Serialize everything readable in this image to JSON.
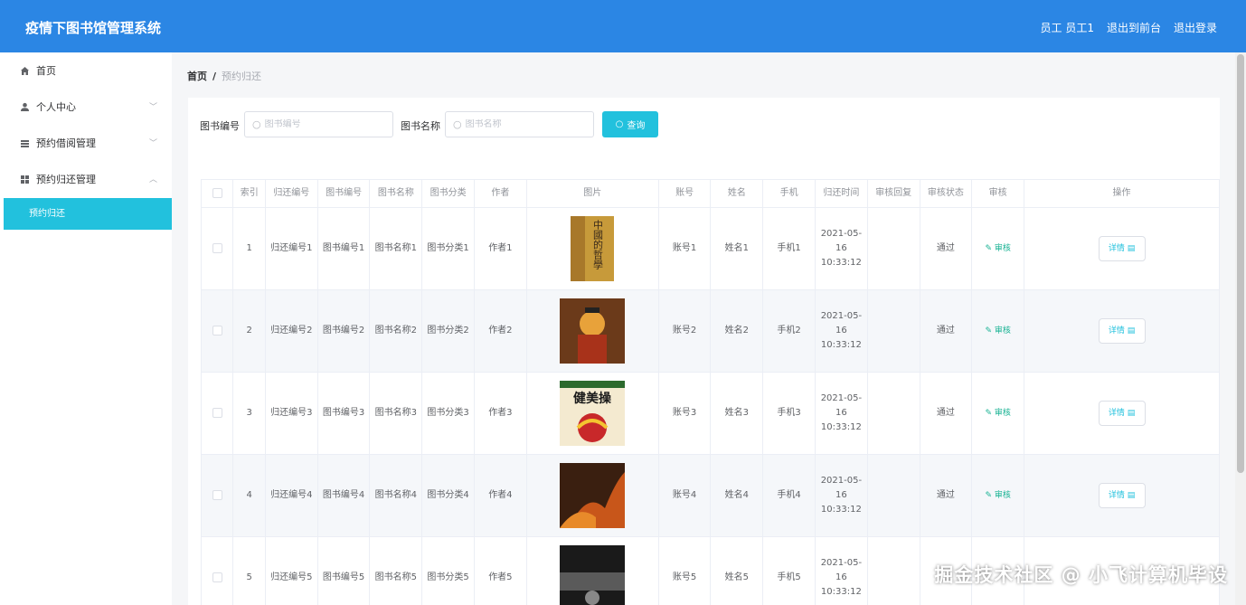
{
  "header": {
    "title": "疫情下图书馆管理系统",
    "nav": [
      "员工 员工1",
      "退出到前台",
      "退出登录"
    ]
  },
  "sidebar": {
    "items": [
      {
        "label": "首页",
        "icon": "home-icon"
      },
      {
        "label": "个人中心",
        "icon": "user-icon"
      },
      {
        "label": "预约借阅管理",
        "icon": "book-stack-icon"
      },
      {
        "label": "预约归还管理",
        "icon": "grid-icon"
      }
    ],
    "active_sub": "预约归还"
  },
  "breadcrumb": {
    "home": "首页",
    "sep": "/",
    "current": "预约归还"
  },
  "search": {
    "book_no_label": "图书编号",
    "book_no_placeholder": "图书编号",
    "book_name_label": "图书名称",
    "book_name_placeholder": "图书名称",
    "button": "查询"
  },
  "table": {
    "headers": [
      "索引",
      "归还编号",
      "图书编号",
      "图书名称",
      "图书分类",
      "作者",
      "图片",
      "账号",
      "姓名",
      "手机",
      "归还时间",
      "审核回复",
      "审核状态",
      "审核",
      "操作"
    ],
    "audit_label": "审核",
    "detail_label": "详情",
    "rows": [
      {
        "index": "1",
        "return_no": "归还编号1",
        "book_no": "图书编号1",
        "book_name": "图书名称1",
        "category": "图书分类1",
        "author": "作者1",
        "cover": "cover-philosophy",
        "account": "账号1",
        "name": "姓名1",
        "phone": "手机1",
        "time": "2021-05-16 10:33:12",
        "reply": "",
        "status": "通过"
      },
      {
        "index": "2",
        "return_no": "归还编号2",
        "book_no": "图书编号2",
        "book_name": "图书名称2",
        "category": "图书分类2",
        "author": "作者2",
        "cover": "cover-anime",
        "account": "账号2",
        "name": "姓名2",
        "phone": "手机2",
        "time": "2021-05-16 10:33:12",
        "reply": "",
        "status": "通过"
      },
      {
        "index": "3",
        "return_no": "归还编号3",
        "book_no": "图书编号3",
        "book_name": "图书名称3",
        "category": "图书分类3",
        "author": "作者3",
        "cover": "cover-aerobics",
        "account": "账号3",
        "name": "姓名3",
        "phone": "手机3",
        "time": "2021-05-16 10:33:12",
        "reply": "",
        "status": "通过"
      },
      {
        "index": "4",
        "return_no": "归还编号4",
        "book_no": "图书编号4",
        "book_name": "图书名称4",
        "category": "图书分类4",
        "author": "作者4",
        "cover": "cover-fire",
        "account": "账号4",
        "name": "姓名4",
        "phone": "手机4",
        "time": "2021-05-16 10:33:12",
        "reply": "",
        "status": "通过"
      },
      {
        "index": "5",
        "return_no": "归还编号5",
        "book_no": "图书编号5",
        "book_name": "图书名称5",
        "category": "图书分类5",
        "author": "作者5",
        "cover": "cover-dark",
        "account": "账号5",
        "name": "姓名5",
        "phone": "手机5",
        "time": "2021-05-16 10:33:12",
        "reply": "",
        "status": ""
      }
    ]
  },
  "cover_texts": {
    "philosophy": "中國的哲學",
    "aerobics": "健美操"
  },
  "watermark": "掘金技术社区 @ 小飞计算机毕设",
  "colors": {
    "header_bg": "#2b86e4",
    "accent": "#22c1dd",
    "audit": "#1ab394"
  }
}
